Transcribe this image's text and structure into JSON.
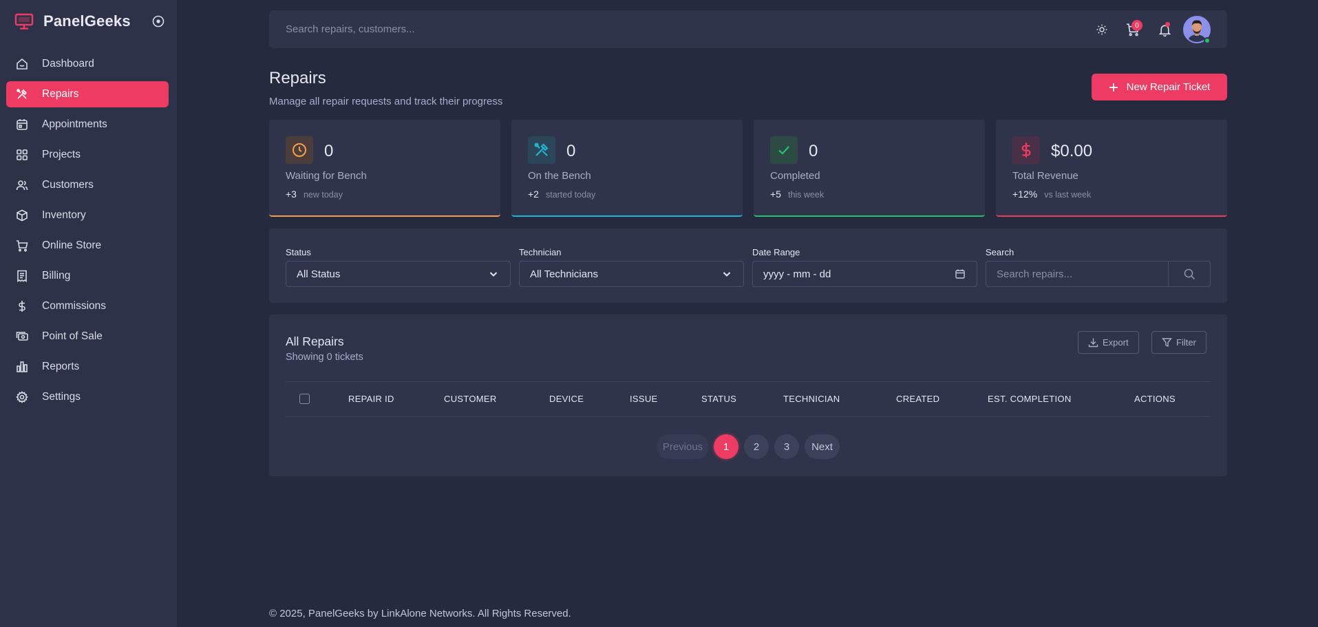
{
  "brand": {
    "name": "PanelGeeks"
  },
  "sidebar": {
    "items": [
      {
        "label": "Dashboard",
        "icon": "home-icon",
        "active": false
      },
      {
        "label": "Repairs",
        "icon": "tools-icon",
        "active": true
      },
      {
        "label": "Appointments",
        "icon": "calendar-icon",
        "active": false
      },
      {
        "label": "Projects",
        "icon": "grid-icon",
        "active": false
      },
      {
        "label": "Customers",
        "icon": "users-icon",
        "active": false
      },
      {
        "label": "Inventory",
        "icon": "box-icon",
        "active": false
      },
      {
        "label": "Online Store",
        "icon": "cart-icon",
        "active": false
      },
      {
        "label": "Billing",
        "icon": "receipt-icon",
        "active": false
      },
      {
        "label": "Commissions",
        "icon": "dollar-icon",
        "active": false
      },
      {
        "label": "Point of Sale",
        "icon": "cash-icon",
        "active": false
      },
      {
        "label": "Reports",
        "icon": "bar-chart-icon",
        "active": false
      },
      {
        "label": "Settings",
        "icon": "gear-icon",
        "active": false
      }
    ]
  },
  "topbar": {
    "search_placeholder": "Search repairs, customers...",
    "cart_count": "0"
  },
  "header": {
    "title": "Repairs",
    "subtitle": "Manage all repair requests and track their progress",
    "new_button": "New Repair Ticket"
  },
  "stats": [
    {
      "value": "0",
      "label": "Waiting for Bench",
      "delta": "+3",
      "note": "new today",
      "accent": "#f5a046"
    },
    {
      "value": "0",
      "label": "On the Bench",
      "delta": "+2",
      "note": "started today",
      "accent": "#21b5d1"
    },
    {
      "value": "0",
      "label": "Completed",
      "delta": "+5",
      "note": "this week",
      "accent": "#25c26e"
    },
    {
      "value": "$0.00",
      "label": "Total Revenue",
      "delta": "+12%",
      "note": "vs last week",
      "accent": "#ee3b63"
    }
  ],
  "filters": {
    "status_label": "Status",
    "status_value": "All Status",
    "technician_label": "Technician",
    "technician_value": "All Technicians",
    "date_label": "Date Range",
    "date_placeholder": "yyyy - mm - dd",
    "search_label": "Search",
    "search_placeholder": "Search repairs..."
  },
  "table": {
    "title": "All Repairs",
    "subtitle": "Showing 0 tickets",
    "export_label": "Export",
    "filter_label": "Filter",
    "columns": [
      "REPAIR ID",
      "CUSTOMER",
      "DEVICE",
      "ISSUE",
      "STATUS",
      "TECHNICIAN",
      "CREATED",
      "EST. COMPLETION",
      "ACTIONS"
    ]
  },
  "pagination": {
    "previous": "Previous",
    "pages": [
      "1",
      "2",
      "3"
    ],
    "current": "1",
    "next": "Next"
  },
  "footer": {
    "text": "© 2025, PanelGeeks by LinkAlone Networks. All Rights Reserved."
  },
  "colors": {
    "accent": "#ee3b63",
    "background": "#262a3f",
    "panel": "#2f344b"
  }
}
